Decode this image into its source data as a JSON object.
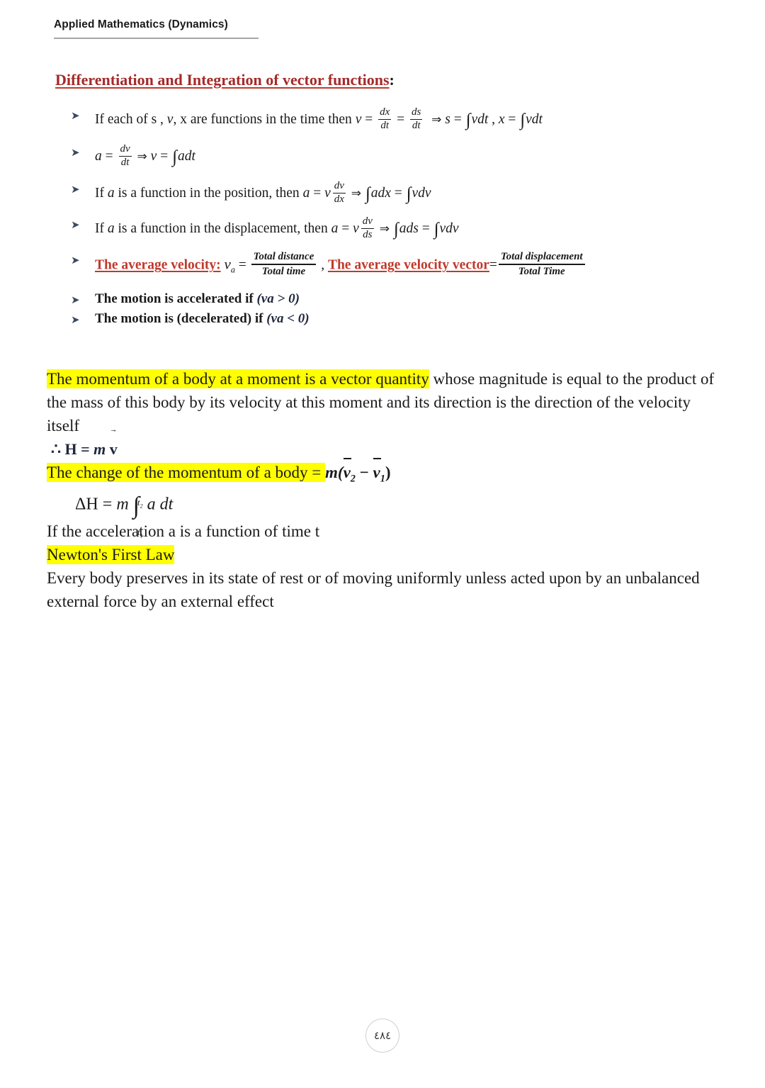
{
  "header": {
    "title": "Applied Mathematics (Dynamics)"
  },
  "section": {
    "title_red": "Differentiation and Integration of vector functions",
    "title_colon": ":"
  },
  "bullets": {
    "arrow_glyph": "➤",
    "items": [
      {
        "id": "functions-of-time",
        "lead": "If each of s , ",
        "var_v": "v",
        "mid": ", x are functions in the time then ",
        "v_eq": "v",
        "eq": "=",
        "frac1_num": "dx",
        "frac1_den": "dt",
        "frac2_num": "ds",
        "frac2_den": "dt",
        "implies": "⇒",
        "s_sym": "s",
        "int1": "∫",
        "int1_body": "vdt",
        "comma": ",",
        "x_sym": "x",
        "int2": "∫",
        "int2_body": "vdt"
      },
      {
        "id": "a-equals-dv-dt",
        "a_sym": "a",
        "eq": "=",
        "frac_num": "dv",
        "frac_den": "dt",
        "implies": "⇒",
        "v_sym": "v",
        "int": "∫",
        "int_body": "adt"
      },
      {
        "id": "a-function-of-position",
        "lead_1": "If ",
        "a_sym": "a",
        "lead_2": " is a function in the position, then ",
        "a_sym2": "a",
        "eq": "=",
        "v_sym": "v",
        "frac_num": "dv",
        "frac_den": "dx",
        "implies": "⇒",
        "int1": "∫",
        "int1_body": "adx",
        "eq2": "=",
        "int2": "∫",
        "int2_body": "vdv"
      },
      {
        "id": "a-function-of-displacement",
        "lead_1": "If ",
        "a_sym": "a",
        "lead_2": " is a function in the displacement, then ",
        "a_sym2": "a",
        "eq": "=",
        "v_sym": "v",
        "frac_num": "dv",
        "frac_den": "ds",
        "implies": "⇒",
        "int1": "∫",
        "int1_body": "ads",
        "eq2": "=",
        "int2": "∫",
        "int2_body": "vdv"
      },
      {
        "id": "average-velocity",
        "label_left": "The average velocity:",
        "va_sym": "v",
        "va_sub": "a",
        "eq1": "=",
        "frac1_num": "Total distance",
        "frac1_den": "Total time",
        "comma": ",",
        "label_right": "The average velocity vector",
        "eq2": "=",
        "frac2_num": "Total displacement",
        "frac2_den": "Total Time"
      },
      {
        "id": "accelerated",
        "text": "The motion is accelerated if ",
        "cond": "(va > 0)"
      },
      {
        "id": "decelerated",
        "text": "The motion is (decelerated) if ",
        "cond": "(va < 0)"
      }
    ]
  },
  "body": {
    "momentum_hl": "The momentum of a body at a moment is a vector quantity",
    "momentum_rest": " whose magnitude is equal to the product of the mass of this body by its velocity at this moment and its direction is the direction of the velocity itself",
    "h_eq_therefore": "∴",
    "h_eq_H": "H",
    "h_eq_mid": " = ",
    "h_eq_m": "m",
    "h_eq_v": "v",
    "change_hl": "The change of the momentum of a body",
    "change_eq": " = ",
    "change_m": "m(",
    "change_v2": "v",
    "change_v2_sub": "2",
    "change_minus": " − ",
    "change_v1": "v",
    "change_v1_sub": "1",
    "change_close": ")",
    "delta_lead": "ΔH = ",
    "delta_m": "m",
    "delta_int": "∫",
    "delta_hi": "t",
    "delta_hi_sub": "2",
    "delta_lo": "t",
    "delta_lo_sub": "1",
    "delta_tail": "a dt",
    "accel_time": "If the acceleration a is a function of time t",
    "newton_hl": "Newton's First Law",
    "newton_text": "Every body preserves in its state of rest or of moving uniformly unless acted upon by an unbalanced external force by an external effect"
  },
  "footer": {
    "page_number": "٤٨٤"
  },
  "colors": {
    "heading_red": "#a52a2a",
    "accent_red": "#c0392b",
    "highlight_yellow": "#ffff00",
    "navy": "#20283d",
    "rule_gray": "#a6a6a6"
  }
}
